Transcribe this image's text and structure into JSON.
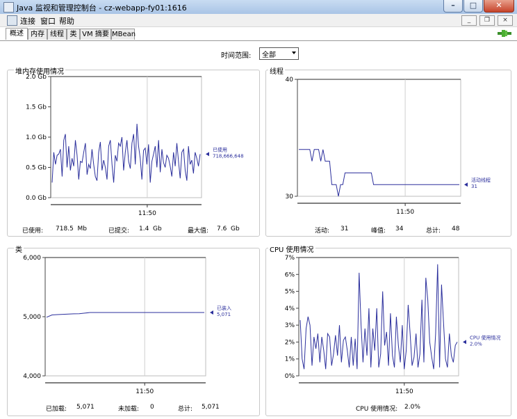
{
  "window": {
    "title": "Java 监视和管理控制台 - cz-webapp-fy01:1616"
  },
  "menu": {
    "items": [
      "连接",
      "窗口",
      "帮助"
    ]
  },
  "tabs": [
    "概述",
    "内存",
    "线程",
    "类",
    "VM 摘要",
    "MBean"
  ],
  "toolbar": {
    "time_range_label": "时间范围:",
    "time_range_value": "全部"
  },
  "panels": {
    "heap": {
      "title": "堆内存使用情况",
      "stats": {
        "used_label": "已使用:",
        "used_value": "718.5  Mb",
        "committed_label": "已提交:",
        "committed_value": "1.4  Gb",
        "max_label": "最大值:",
        "max_value": "7.6  Gb"
      }
    },
    "threads": {
      "title": "线程",
      "stats": {
        "live_label": "活动:",
        "live_value": "31",
        "peak_label": "峰值:",
        "peak_value": "34",
        "total_label": "总计:",
        "total_value": "48"
      }
    },
    "classes": {
      "title": "类",
      "stats": {
        "loaded_label": "已加载:",
        "loaded_value": "5,071",
        "unloaded_label": "未加载:",
        "unloaded_value": "0",
        "total_label": "总计:",
        "total_value": "5,071"
      }
    },
    "cpu": {
      "title": "CPU 使用情况",
      "stats": {
        "label": "CPU 使用情况:",
        "value": "2.0%"
      }
    }
  },
  "chart_data": [
    {
      "type": "line",
      "ylim": [
        0,
        2.0
      ],
      "yticks": [
        "0.0 Gb",
        "0.5 Gb",
        "1.0 Gb",
        "1.5 Gb",
        "2.0 Gb"
      ],
      "xticks": [
        "11:50"
      ],
      "series": [
        {
          "name": "已使用",
          "legend_value": "718,666,648",
          "values": [
            0.25,
            0.75,
            0.55,
            0.7,
            0.72,
            0.8,
            0.35,
            0.95,
            1.05,
            0.5,
            0.85,
            0.45,
            0.65,
            0.52,
            0.95,
            0.7,
            0.3,
            0.6,
            0.58,
            0.75,
            0.9,
            0.38,
            0.55,
            0.48,
            0.8,
            0.55,
            0.35,
            0.28,
            0.75,
            0.92,
            0.45,
            0.62,
            0.5,
            0.3,
            0.85,
            0.95,
            0.55,
            0.25,
            0.7,
            0.6,
            0.9,
            0.85,
            1.0,
            0.45,
            0.75,
            0.95,
            0.6,
            0.48,
            0.9,
            1.05,
            0.55,
            1.22,
            0.85,
            0.65,
            0.3,
            0.78,
            0.82,
            0.55,
            0.88,
            0.25,
            0.6,
            0.72,
            0.85,
            0.5,
            0.95,
            0.42,
            0.8,
            0.58,
            0.5,
            0.7,
            0.65,
            0.52,
            0.35,
            0.75,
            0.52,
            0.9,
            0.6,
            0.32,
            0.75,
            0.8,
            0.45,
            0.28,
            0.85,
            0.55,
            0.62,
            0.4,
            0.75,
            0.65,
            0.52,
            0.72
          ]
        }
      ]
    },
    {
      "type": "line",
      "ylim": [
        30,
        40
      ],
      "yticks": [
        "30",
        "40"
      ],
      "xticks": [
        "11:50"
      ],
      "series": [
        {
          "name": "活动线程",
          "legend_value": "31",
          "values": [
            34,
            34,
            34,
            34,
            34,
            34,
            33,
            34,
            34,
            34,
            33,
            34,
            33,
            33,
            33,
            31,
            31,
            31,
            30,
            31,
            31,
            32,
            32,
            32,
            32,
            32,
            32,
            32,
            32,
            32,
            32,
            32,
            32,
            32,
            31,
            31,
            31,
            31,
            31,
            31,
            31,
            31,
            31,
            31,
            31,
            31,
            31,
            31,
            31,
            31,
            31,
            31,
            31,
            31,
            31,
            31,
            31,
            31,
            31,
            31,
            31,
            31,
            31,
            31,
            31,
            31,
            31,
            31,
            31,
            31,
            31,
            31,
            31,
            31
          ]
        }
      ]
    },
    {
      "type": "line",
      "ylim": [
        4000,
        6000
      ],
      "yticks": [
        "4,000",
        "5,000",
        "6,000"
      ],
      "xticks": [
        "11:50"
      ],
      "series": [
        {
          "name": "已装入",
          "legend_value": "5,071",
          "values": [
            4990,
            5030,
            5035,
            5040,
            5045,
            5048,
            5050,
            5060,
            5071,
            5071,
            5071,
            5071,
            5071,
            5071,
            5071,
            5071,
            5071,
            5071,
            5071,
            5071,
            5071,
            5071,
            5071,
            5071,
            5071,
            5071,
            5071,
            5071,
            5071,
            5071
          ]
        }
      ]
    },
    {
      "type": "line",
      "ylim": [
        0,
        7
      ],
      "yticks": [
        "0%",
        "1%",
        "2%",
        "3%",
        "4%",
        "5%",
        "6%",
        "7%"
      ],
      "xticks": [
        "11:50"
      ],
      "series": [
        {
          "name": "CPU 使用情况",
          "legend_value": "2.0%",
          "values": [
            3.3,
            1.0,
            0.4,
            2.8,
            3.5,
            3.0,
            0.6,
            2.3,
            1.6,
            2.5,
            0.8,
            2.3,
            1.5,
            0.4,
            2.5,
            2.3,
            0.6,
            1.3,
            2.4,
            1.2,
            3.0,
            0.8,
            2.1,
            2.3,
            1.5,
            0.5,
            2.3,
            0.6,
            2.2,
            0.4,
            6.1,
            3.0,
            0.8,
            2.8,
            1.2,
            4.0,
            0.5,
            2.8,
            1.5,
            4.0,
            0.5,
            1.3,
            5.0,
            1.8,
            2.6,
            0.6,
            3.7,
            1.2,
            0.5,
            3.5,
            1.8,
            0.8,
            3.0,
            0.4,
            1.5,
            4.2,
            2.5,
            0.6,
            1.1,
            2.5,
            0.5,
            1.3,
            4.5,
            0.8,
            5.8,
            4.5,
            2.0,
            1.1,
            0.4,
            2.5,
            6.6,
            0.5,
            5.4,
            3.2,
            1.0,
            0.5,
            2.5,
            1.2,
            0.8,
            1.8,
            2.0
          ]
        }
      ]
    }
  ]
}
